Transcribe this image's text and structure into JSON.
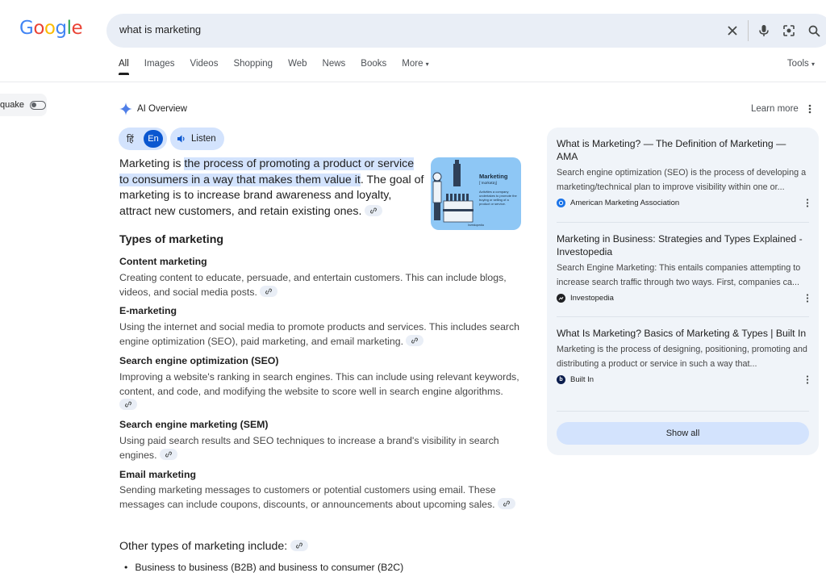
{
  "logo": {
    "g1": "G",
    "o1": "o",
    "o2": "o",
    "g2": "g",
    "l": "l",
    "e": "e"
  },
  "search": {
    "query": "what is marketing"
  },
  "tabs": [
    "All",
    "Images",
    "Videos",
    "Shopping",
    "Web",
    "News",
    "Books",
    "More"
  ],
  "tools_label": "Tools",
  "sidebar": {
    "quake_label": "quake"
  },
  "ai_overview": {
    "heading": "AI Overview",
    "learn_more": "Learn more",
    "lang_hindi": "हिं",
    "lang_english": "En",
    "listen": "Listen",
    "lead_pre": "Marketing is ",
    "lead_highlight": "the process of promoting a product or service to consumers in a way that makes them value it",
    "lead_post": ". The goal of marketing is to increase brand awareness and loyalty, attract new customers, and retain existing ones.",
    "thumbnail": {
      "title": "Marketing",
      "subtitle": "[ˈmɑrkətɪŋ]",
      "description": "Activities a company undertakes to promote the buying or selling of a product or service.",
      "brand": "Investopedia"
    },
    "types_heading": "Types of marketing",
    "sections": [
      {
        "title": "Content marketing",
        "body": "Creating content to educate, persuade, and entertain customers. This can include blogs, videos, and social media posts."
      },
      {
        "title": "E-marketing",
        "body": "Using the internet and social media to promote products and services. This includes search engine optimization (SEO), paid marketing, and email marketing."
      },
      {
        "title": "Search engine optimization (SEO)",
        "body": "Improving a website's ranking in search engines. This can include using relevant keywords, content, and code, and modifying the website to score well in search engine algorithms."
      },
      {
        "title": "Search engine marketing (SEM)",
        "body": "Using paid search results and SEO techniques to increase a brand's visibility in search engines."
      },
      {
        "title": "Email marketing",
        "body": "Sending marketing messages to customers or potential customers using email. These messages can include coupons, discounts, or announcements about upcoming sales."
      }
    ],
    "other_heading": "Other types of marketing include:",
    "bullets": [
      "Business to business (B2B) and business to consumer (B2C)"
    ]
  },
  "sources": [
    {
      "title": "What is Marketing? — The Definition of Marketing — AMA",
      "snippet": "Search engine optimization (SEO) is the process of developing a marketing/technical plan to improve visibility within one or...",
      "site": "American Marketing Association",
      "favicon_color": "#1a73e8"
    },
    {
      "title": "Marketing in Business: Strategies and Types Explained - Investopedia",
      "snippet": "Search Engine Marketing: This entails companies attempting to increase search traffic through two ways. First, companies ca...",
      "site": "Investopedia",
      "favicon_color": "#202124"
    },
    {
      "title": "What Is Marketing? Basics of Marketing & Types | Built In",
      "snippet": "Marketing is the process of designing, positioning, promoting and distributing a product or service in such a way that...",
      "site": "Built In",
      "favicon_color": "#0b1d4d",
      "favicon_letter": "b"
    }
  ],
  "show_all": "Show all"
}
